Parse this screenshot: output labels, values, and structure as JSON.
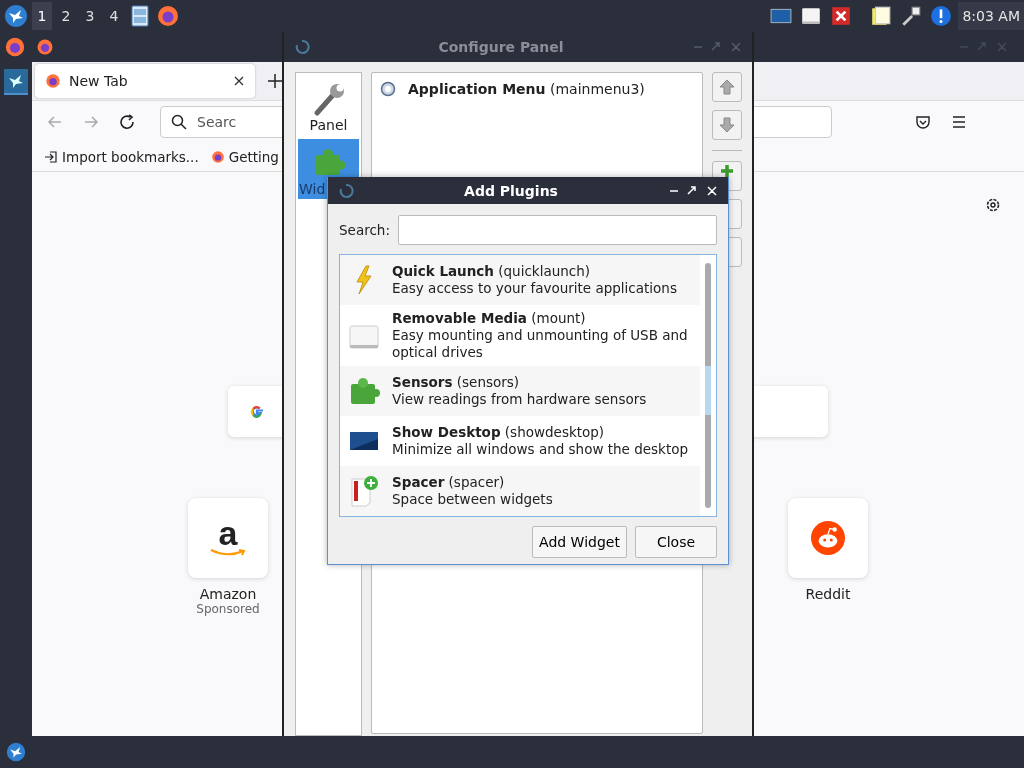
{
  "top_panel": {
    "workspaces": [
      {
        "label": "1",
        "selected": true
      },
      {
        "label": "2",
        "selected": false
      },
      {
        "label": "3",
        "selected": false
      },
      {
        "label": "4",
        "selected": false
      }
    ],
    "clock": "8:03 AM"
  },
  "browser": {
    "tabs": [
      {
        "title": "New Tab",
        "selected": true
      }
    ],
    "search": {
      "placeholder": "Searc"
    },
    "bookmarks": [
      "Import bookmarks...",
      "Getting"
    ],
    "shortcuts": [
      {
        "logo": "a",
        "label": "Amazon",
        "sublabel": "Sponsored"
      },
      {
        "label": "Reddit"
      }
    ]
  },
  "configure_panel": {
    "title": "Configure Panel",
    "active": false,
    "pages": [
      {
        "kind": "panel",
        "label": "Panel",
        "selected": false
      },
      {
        "kind": "widgets",
        "label": "Wid",
        "selected": true
      }
    ],
    "widgets": [
      {
        "title": "**Application Menu** (mainmenu3)"
      }
    ]
  },
  "add_plugins": {
    "title": "Add Plugins",
    "active": true,
    "search": {
      "label": "Search:"
    },
    "plugins": [
      {
        "kind": "launcher",
        "title": "**Quick Launch** (quicklaunch)",
        "description": "Easy access to your favourite applications"
      },
      {
        "kind": "media",
        "title": "**Removable Media** (mount)",
        "description": "Easy mounting and unmounting of USB and optical drives"
      },
      {
        "kind": "sensors",
        "title": "**Sensors** (sensors)",
        "description": "View readings from hardware sensors"
      },
      {
        "kind": "desktop",
        "title": "**Show Desktop** (showdesktop)",
        "description": "Minimize all windows and show the desktop"
      },
      {
        "kind": "spacer",
        "title": "**Spacer** (spacer)",
        "description": "Space between widgets"
      }
    ],
    "buttons": [
      "Add Widget",
      "Close"
    ]
  }
}
